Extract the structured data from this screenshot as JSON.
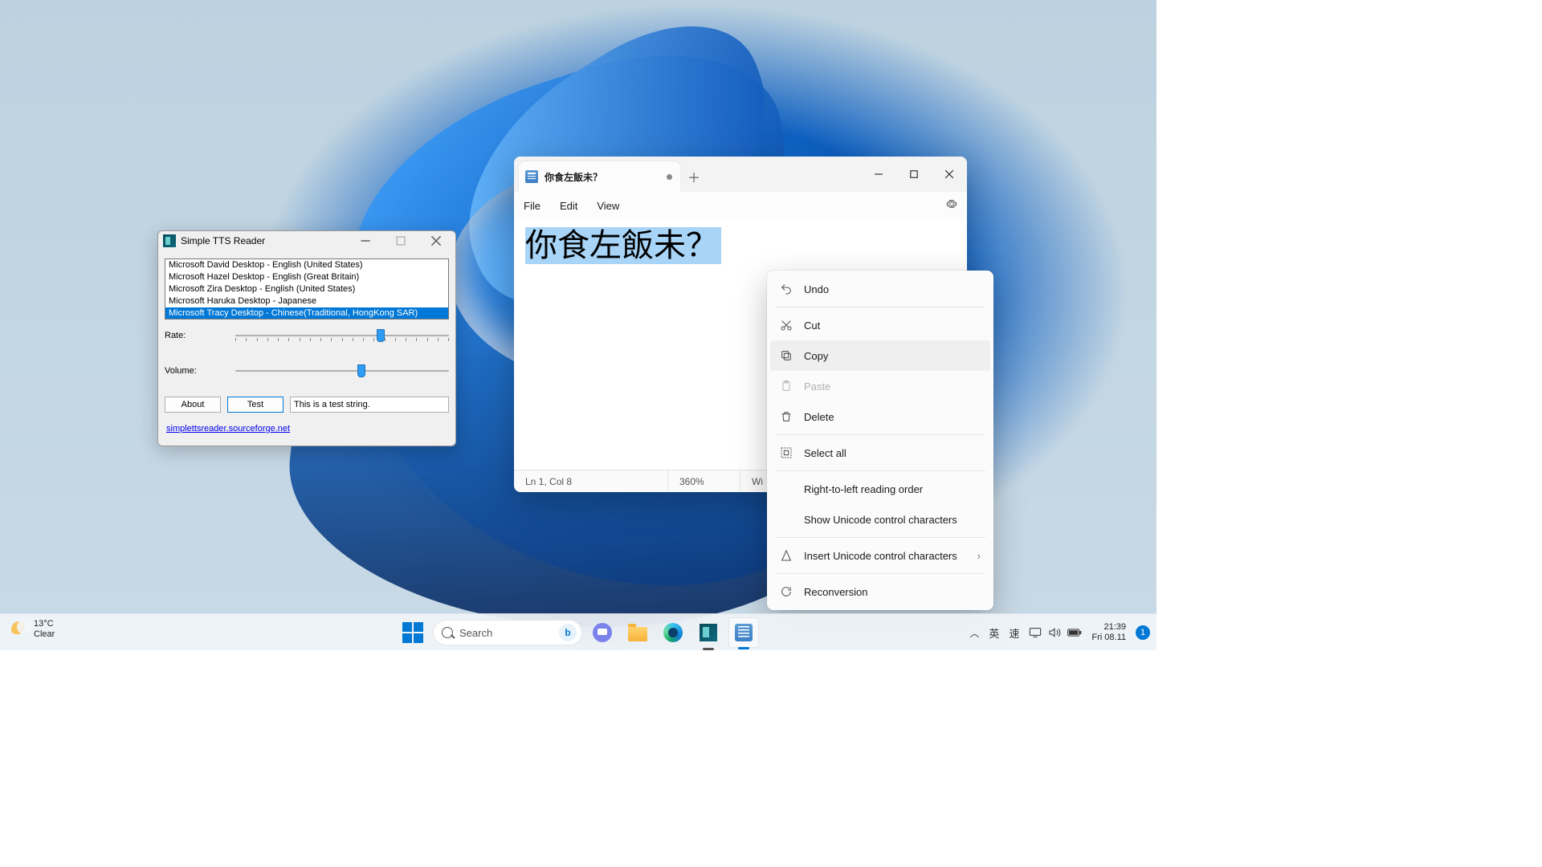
{
  "tts": {
    "title": "Simple TTS Reader",
    "voices": [
      "Microsoft David Desktop - English (United States)",
      "Microsoft Hazel Desktop - English (Great Britain)",
      "Microsoft Zira Desktop - English (United States)",
      "Microsoft Haruka Desktop - Japanese",
      "Microsoft Tracy Desktop - Chinese(Traditional, HongKong SAR)"
    ],
    "selected_index": 4,
    "rate_label": "Rate:",
    "volume_label": "Volume:",
    "about_label": "About",
    "test_label": "Test",
    "test_value": "This is a test string.",
    "link": "simplettsreader.sourceforge.net"
  },
  "notepad": {
    "tab_title": "你食左飯未？",
    "menus": {
      "file": "File",
      "edit": "Edit",
      "view": "View"
    },
    "text_content": "你食左飯未？",
    "status": {
      "pos": "Ln 1, Col 8",
      "zoom": "360%",
      "crlf_partial": "Wi"
    }
  },
  "context_menu": {
    "undo": "Undo",
    "cut": "Cut",
    "copy": "Copy",
    "paste": "Paste",
    "delete": "Delete",
    "select_all": "Select all",
    "rtl": "Right-to-left reading order",
    "unicode_show": "Show Unicode control characters",
    "unicode_insert": "Insert Unicode control characters",
    "reconversion": "Reconversion"
  },
  "taskbar": {
    "weather_temp": "13°C",
    "weather_cond": "Clear",
    "search_placeholder": "Search",
    "ime_lang": "英",
    "ime_mode": "速",
    "time": "21:39",
    "date": "Fri 08.11",
    "notif_count": "1"
  }
}
